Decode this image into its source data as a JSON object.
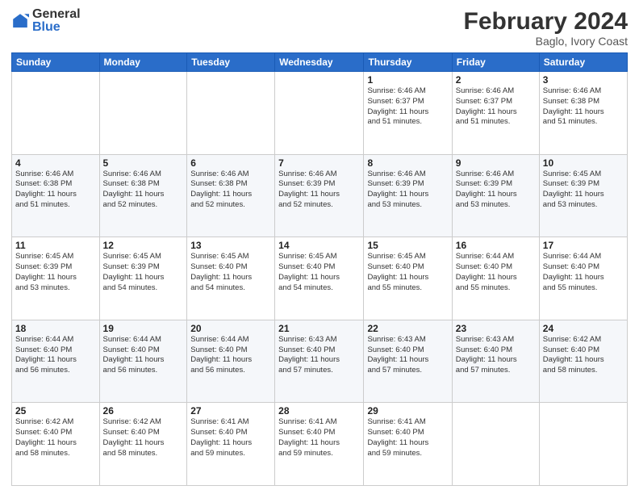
{
  "logo": {
    "general": "General",
    "blue": "Blue"
  },
  "title": "February 2024",
  "subtitle": "Baglo, Ivory Coast",
  "days_header": [
    "Sunday",
    "Monday",
    "Tuesday",
    "Wednesday",
    "Thursday",
    "Friday",
    "Saturday"
  ],
  "weeks": [
    [
      {
        "day": "",
        "info": ""
      },
      {
        "day": "",
        "info": ""
      },
      {
        "day": "",
        "info": ""
      },
      {
        "day": "",
        "info": ""
      },
      {
        "day": "1",
        "info": "Sunrise: 6:46 AM\nSunset: 6:37 PM\nDaylight: 11 hours\nand 51 minutes."
      },
      {
        "day": "2",
        "info": "Sunrise: 6:46 AM\nSunset: 6:37 PM\nDaylight: 11 hours\nand 51 minutes."
      },
      {
        "day": "3",
        "info": "Sunrise: 6:46 AM\nSunset: 6:38 PM\nDaylight: 11 hours\nand 51 minutes."
      }
    ],
    [
      {
        "day": "4",
        "info": "Sunrise: 6:46 AM\nSunset: 6:38 PM\nDaylight: 11 hours\nand 51 minutes."
      },
      {
        "day": "5",
        "info": "Sunrise: 6:46 AM\nSunset: 6:38 PM\nDaylight: 11 hours\nand 52 minutes."
      },
      {
        "day": "6",
        "info": "Sunrise: 6:46 AM\nSunset: 6:38 PM\nDaylight: 11 hours\nand 52 minutes."
      },
      {
        "day": "7",
        "info": "Sunrise: 6:46 AM\nSunset: 6:39 PM\nDaylight: 11 hours\nand 52 minutes."
      },
      {
        "day": "8",
        "info": "Sunrise: 6:46 AM\nSunset: 6:39 PM\nDaylight: 11 hours\nand 53 minutes."
      },
      {
        "day": "9",
        "info": "Sunrise: 6:46 AM\nSunset: 6:39 PM\nDaylight: 11 hours\nand 53 minutes."
      },
      {
        "day": "10",
        "info": "Sunrise: 6:45 AM\nSunset: 6:39 PM\nDaylight: 11 hours\nand 53 minutes."
      }
    ],
    [
      {
        "day": "11",
        "info": "Sunrise: 6:45 AM\nSunset: 6:39 PM\nDaylight: 11 hours\nand 53 minutes."
      },
      {
        "day": "12",
        "info": "Sunrise: 6:45 AM\nSunset: 6:39 PM\nDaylight: 11 hours\nand 54 minutes."
      },
      {
        "day": "13",
        "info": "Sunrise: 6:45 AM\nSunset: 6:40 PM\nDaylight: 11 hours\nand 54 minutes."
      },
      {
        "day": "14",
        "info": "Sunrise: 6:45 AM\nSunset: 6:40 PM\nDaylight: 11 hours\nand 54 minutes."
      },
      {
        "day": "15",
        "info": "Sunrise: 6:45 AM\nSunset: 6:40 PM\nDaylight: 11 hours\nand 55 minutes."
      },
      {
        "day": "16",
        "info": "Sunrise: 6:44 AM\nSunset: 6:40 PM\nDaylight: 11 hours\nand 55 minutes."
      },
      {
        "day": "17",
        "info": "Sunrise: 6:44 AM\nSunset: 6:40 PM\nDaylight: 11 hours\nand 55 minutes."
      }
    ],
    [
      {
        "day": "18",
        "info": "Sunrise: 6:44 AM\nSunset: 6:40 PM\nDaylight: 11 hours\nand 56 minutes."
      },
      {
        "day": "19",
        "info": "Sunrise: 6:44 AM\nSunset: 6:40 PM\nDaylight: 11 hours\nand 56 minutes."
      },
      {
        "day": "20",
        "info": "Sunrise: 6:44 AM\nSunset: 6:40 PM\nDaylight: 11 hours\nand 56 minutes."
      },
      {
        "day": "21",
        "info": "Sunrise: 6:43 AM\nSunset: 6:40 PM\nDaylight: 11 hours\nand 57 minutes."
      },
      {
        "day": "22",
        "info": "Sunrise: 6:43 AM\nSunset: 6:40 PM\nDaylight: 11 hours\nand 57 minutes."
      },
      {
        "day": "23",
        "info": "Sunrise: 6:43 AM\nSunset: 6:40 PM\nDaylight: 11 hours\nand 57 minutes."
      },
      {
        "day": "24",
        "info": "Sunrise: 6:42 AM\nSunset: 6:40 PM\nDaylight: 11 hours\nand 58 minutes."
      }
    ],
    [
      {
        "day": "25",
        "info": "Sunrise: 6:42 AM\nSunset: 6:40 PM\nDaylight: 11 hours\nand 58 minutes."
      },
      {
        "day": "26",
        "info": "Sunrise: 6:42 AM\nSunset: 6:40 PM\nDaylight: 11 hours\nand 58 minutes."
      },
      {
        "day": "27",
        "info": "Sunrise: 6:41 AM\nSunset: 6:40 PM\nDaylight: 11 hours\nand 59 minutes."
      },
      {
        "day": "28",
        "info": "Sunrise: 6:41 AM\nSunset: 6:40 PM\nDaylight: 11 hours\nand 59 minutes."
      },
      {
        "day": "29",
        "info": "Sunrise: 6:41 AM\nSunset: 6:40 PM\nDaylight: 11 hours\nand 59 minutes."
      },
      {
        "day": "",
        "info": ""
      },
      {
        "day": "",
        "info": ""
      }
    ]
  ]
}
